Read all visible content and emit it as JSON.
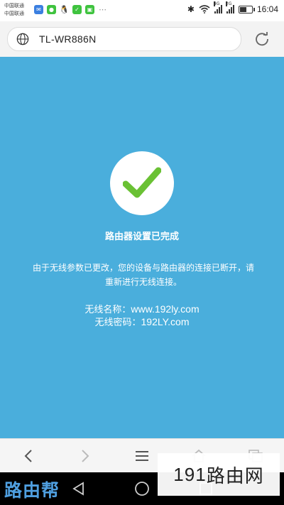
{
  "status_bar": {
    "carrier_1": "中国联通",
    "carrier_2": "中国联通",
    "signal_1_label": "4G",
    "signal_2_label": "2G",
    "battery_level": 0.55,
    "time": "16:04",
    "notification_icons": [
      "message-icon",
      "wechat-icon",
      "qq-icon",
      "check-app-icon",
      "image-icon",
      "more-icon"
    ]
  },
  "address_bar": {
    "url": "TL-WR886N"
  },
  "page": {
    "background": "#4aaedc",
    "check_color": "#6ac134",
    "title": "路由器设置已完成",
    "message": "由于无线参数已更改，您的设备与路由器的连接已断开，请重新进行无线连接。",
    "ssid_label": "无线名称：",
    "ssid_value": "www.192ly.com",
    "password_label": "无线密码：",
    "password_value": "192LY.com"
  },
  "watermarks": {
    "left": "路由帮",
    "right_num": "191",
    "right_text": "路由网"
  }
}
